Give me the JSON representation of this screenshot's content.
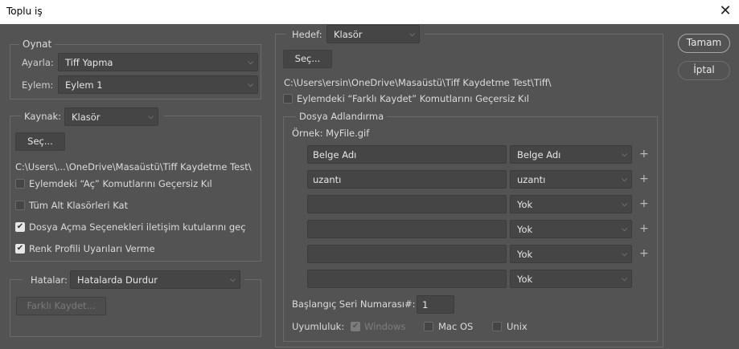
{
  "window": {
    "title": "Toplu iş",
    "close": "✕"
  },
  "play": {
    "legend": "Oynat",
    "set_label": "Ayarla:",
    "set_value": "Tiff Yapma",
    "action_label": "Eylem:",
    "action_value": "Eylem 1"
  },
  "source": {
    "label": "Kaynak:",
    "value": "Klasör",
    "choose": "Seç...",
    "path": "C:\\Users\\...\\OneDrive\\Masaüstü\\Tiff Kaydetme Test\\",
    "options": [
      {
        "label": "Eylemdeki “Aç” Komutlarını Geçersiz Kıl",
        "checked": false
      },
      {
        "label": "Tüm Alt Klasörleri Kat",
        "checked": false
      },
      {
        "label": "Dosya Açma Seçenekleri iletişim kutularını geç",
        "checked": true
      },
      {
        "label": "Renk Profili Uyarıları Verme",
        "checked": true
      }
    ]
  },
  "errors": {
    "label": "Hatalar:",
    "value": "Hatalarda Durdur",
    "save_as": "Farklı Kaydet..."
  },
  "destination": {
    "label": "Hedef:",
    "value": "Klasör",
    "choose": "Seç...",
    "path": "C:\\Users\\ersin\\OneDrive\\Masaüstü\\Tiff Kaydetme Test\\Tiff\\",
    "override": "Eylemdeki “Farklı Kaydet” Komutlarını Geçersiz Kıl",
    "override_checked": false
  },
  "naming": {
    "legend": "Dosya Adlandırma",
    "example": "Örnek: MyFile.gif",
    "rows": [
      {
        "text": "Belge Adı",
        "select": "Belge Adı"
      },
      {
        "text": "uzantı",
        "select": "uzantı"
      },
      {
        "text": "",
        "select": "Yok"
      },
      {
        "text": "",
        "select": "Yok"
      },
      {
        "text": "",
        "select": "Yok"
      },
      {
        "text": "",
        "select": "Yok"
      }
    ],
    "serial_label": "Başlangıç Seri Numarası#:",
    "serial_value": "1",
    "compat_label": "Uyumluluk:",
    "windows": "Windows",
    "macos": "Mac OS",
    "unix": "Unix"
  },
  "buttons": {
    "ok": "Tamam",
    "cancel": "İptal"
  }
}
